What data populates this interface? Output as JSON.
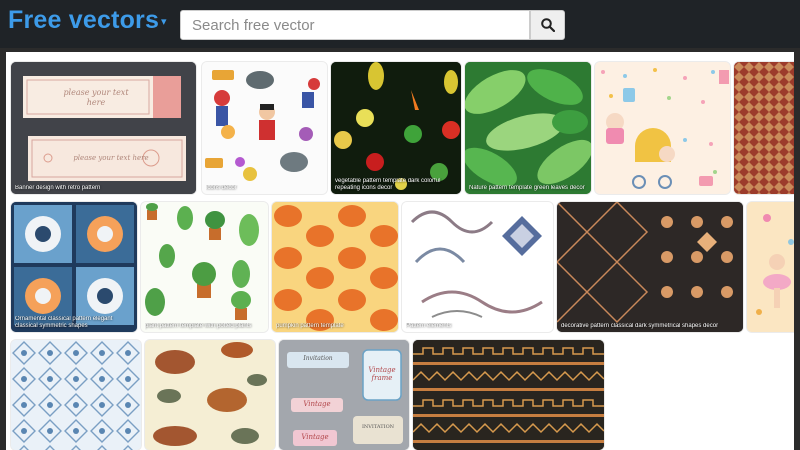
{
  "header": {
    "logo": "Free vectors",
    "search_placeholder": "Search free vector",
    "colors": {
      "brand": "#3d9be9",
      "bar": "#1f2327"
    }
  },
  "gallery": {
    "tiles": [
      {
        "id": "t1",
        "caption": "Banner design with retro pattern",
        "banner_text": "please your text here",
        "banner_text2": "please your text here"
      },
      {
        "id": "t2",
        "caption": "icons decor"
      },
      {
        "id": "t3",
        "caption": "vegetable pattern template dark colorful repeating icons decor"
      },
      {
        "id": "t4",
        "caption": "Nature pattern template green leaves decor"
      },
      {
        "id": "t5",
        "caption": ""
      },
      {
        "id": "t6",
        "caption": ""
      },
      {
        "id": "t7",
        "caption": "Ornamental classical pattern elegant classical symmetric shapes"
      },
      {
        "id": "t8",
        "caption": "plant pattern template with potted plants"
      },
      {
        "id": "t9",
        "caption": "pumpkin pattern template"
      },
      {
        "id": "t10",
        "caption": "Pattern elements"
      },
      {
        "id": "t11",
        "caption": "decorative pattern classical dark symmetrical shapes decor"
      },
      {
        "id": "t12",
        "caption": ""
      },
      {
        "id": "t13",
        "caption": ""
      },
      {
        "id": "t14",
        "caption": ""
      },
      {
        "id": "t15",
        "caption": "",
        "labels": [
          "Vintage frame",
          "Vintage",
          "INVITATION",
          "Vintage",
          "Invitation"
        ]
      },
      {
        "id": "t16",
        "caption": ""
      }
    ]
  }
}
